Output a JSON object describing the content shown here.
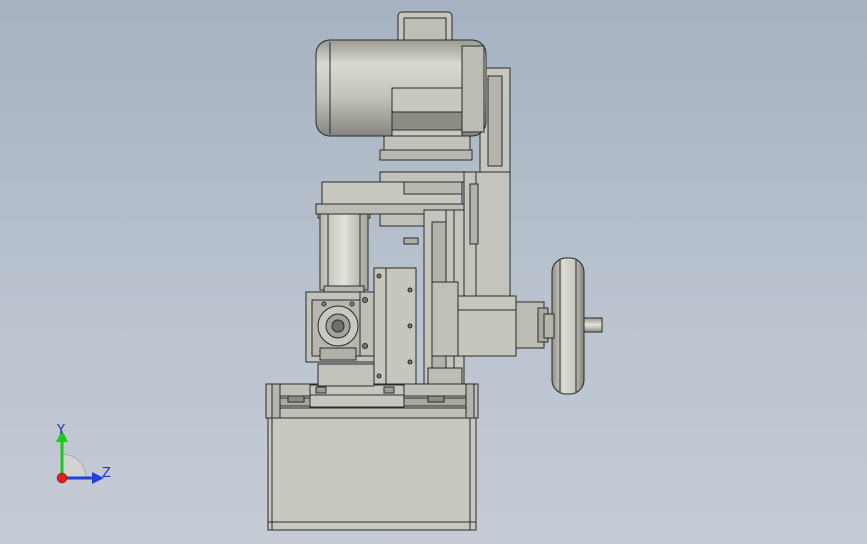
{
  "viewport": {
    "background_top": "#a6b2c2",
    "background_bottom": "#c6ccd6"
  },
  "model": {
    "part_fill": "#c4c4bc",
    "part_shadow": "#a6a69e",
    "edge_color": "#2a2a2a",
    "dark_band": "#8c8c84"
  },
  "triad": {
    "y_label": "Y",
    "z_label": "Z",
    "y_color": "#1ec81e",
    "z_color": "#2040e0",
    "x_color": "#e02020"
  }
}
